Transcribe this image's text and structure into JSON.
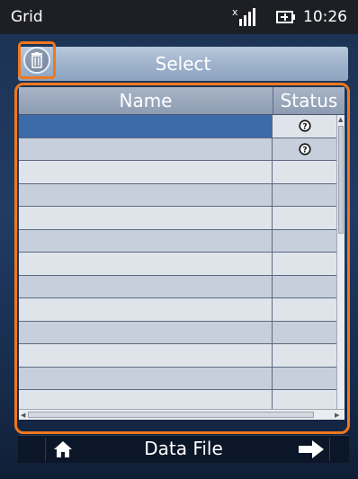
{
  "status_bar": {
    "title": "Grid",
    "time": "10:26"
  },
  "header": {
    "title": "Select"
  },
  "grid": {
    "columns": [
      "Name",
      "Status"
    ],
    "rows": [
      {
        "name": "",
        "status_icon": "question-icon",
        "selected": true
      },
      {
        "name": "",
        "status_icon": "question-icon",
        "selected": false
      },
      {
        "name": "",
        "status_icon": "",
        "selected": false
      },
      {
        "name": "",
        "status_icon": "",
        "selected": false
      },
      {
        "name": "",
        "status_icon": "",
        "selected": false
      },
      {
        "name": "",
        "status_icon": "",
        "selected": false
      },
      {
        "name": "",
        "status_icon": "",
        "selected": false
      },
      {
        "name": "",
        "status_icon": "",
        "selected": false
      },
      {
        "name": "",
        "status_icon": "",
        "selected": false
      },
      {
        "name": "",
        "status_icon": "",
        "selected": false
      },
      {
        "name": "",
        "status_icon": "",
        "selected": false
      },
      {
        "name": "",
        "status_icon": "",
        "selected": false
      },
      {
        "name": "",
        "status_icon": "",
        "selected": false
      }
    ]
  },
  "bottom_bar": {
    "label": "Data File"
  },
  "colors": {
    "accent": "#f0781e",
    "selected_row": "#3d6aa8"
  }
}
